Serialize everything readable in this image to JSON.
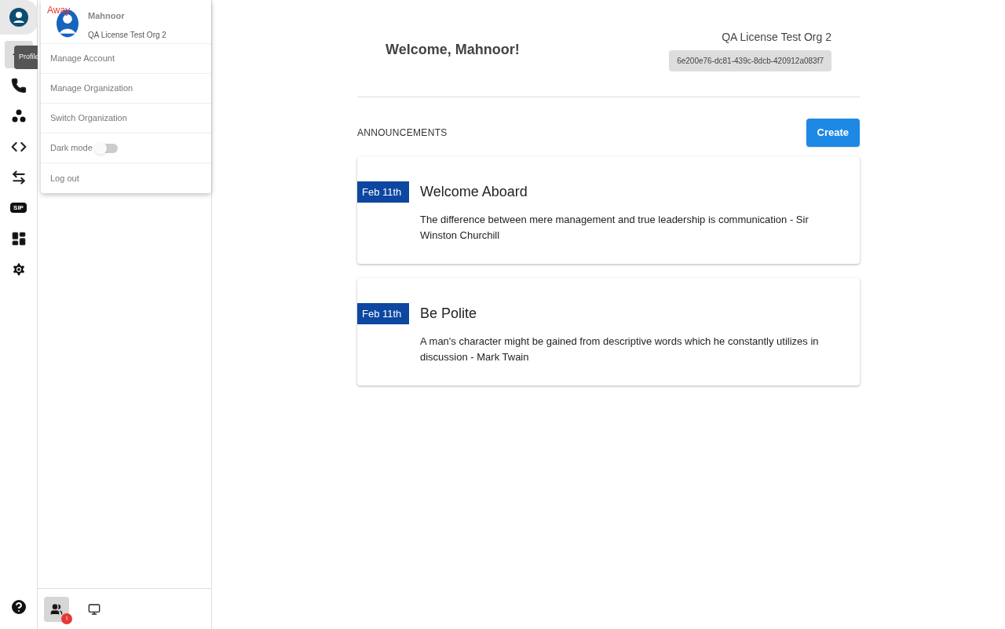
{
  "rail": {
    "items": [
      {
        "kind": "home",
        "selected": true
      },
      {
        "kind": "phone",
        "selected": false
      },
      {
        "kind": "dots",
        "selected": false
      },
      {
        "kind": "code",
        "selected": false
      },
      {
        "kind": "swap",
        "selected": false
      },
      {
        "kind": "sip",
        "label": "SIP",
        "selected": false
      },
      {
        "kind": "dashboard",
        "selected": false
      },
      {
        "kind": "settings",
        "selected": false
      }
    ],
    "tooltip": "Profile"
  },
  "profile_menu": {
    "status": "Away",
    "name": "Mahnoor",
    "org": "QA License Test Org 2",
    "items": [
      {
        "kind": "link",
        "label": "Manage Account"
      },
      {
        "kind": "link",
        "label": "Manage Organization"
      },
      {
        "kind": "link",
        "label": "Switch Organization"
      },
      {
        "kind": "toggle",
        "label": "Dark mode",
        "on": false
      },
      {
        "kind": "link",
        "label": "Log out"
      }
    ]
  },
  "panel_footer": [
    {
      "kind": "people",
      "selected": true,
      "badge": "!"
    },
    {
      "kind": "screen",
      "selected": false
    }
  ],
  "header": {
    "welcome": "Welcome, Mahnoor!",
    "org": "QA License Test Org 2",
    "org_id": "6e200e76-dc81-439c-8dcb-420912a083f7"
  },
  "announcements": {
    "title": "ANNOUNCEMENTS",
    "create": "Create",
    "items": [
      {
        "date": "Feb 11th",
        "title": "Welcome Aboard",
        "body": "The difference between mere management and true leadership is communication - Sir Winston Churchill"
      },
      {
        "date": "Feb 11th",
        "title": "Be Polite",
        "body": "A man's character might be gained from descriptive words which he constantly utilizes in discussion - Mark Twain"
      }
    ]
  }
}
